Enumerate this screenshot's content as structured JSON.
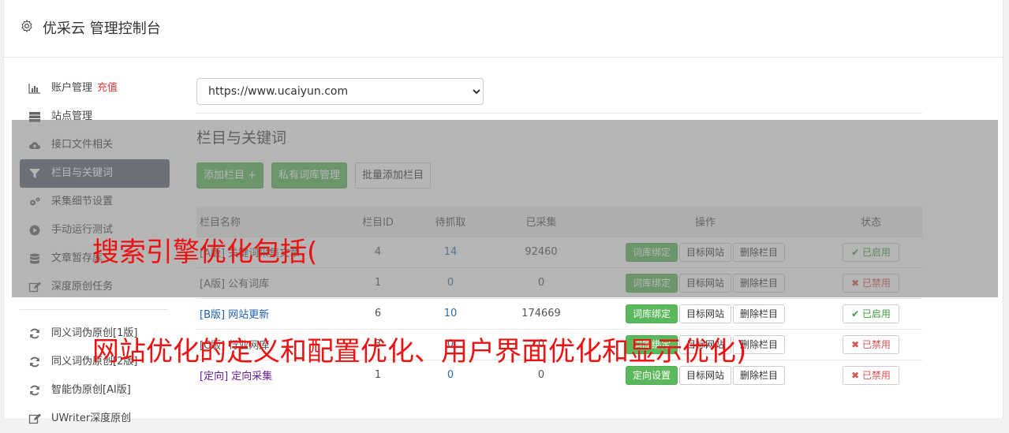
{
  "header": {
    "title": "优采云 管理控制台",
    "icon": "gear-icon"
  },
  "sidebar": {
    "group1": [
      {
        "label": "账户管理",
        "extra": "充值",
        "icon": "bar-chart-icon"
      },
      {
        "label": "站点管理",
        "icon": "server-icon"
      },
      {
        "label": "接口文件相关",
        "icon": "cloud-upload-icon"
      },
      {
        "label": "栏目与关键词",
        "icon": "filter-icon",
        "active": true
      },
      {
        "label": "采集细节设置",
        "icon": "cogs-icon"
      },
      {
        "label": "手动运行测试",
        "icon": "play-circle-icon"
      },
      {
        "label": "文章暂存库",
        "icon": "database-icon"
      },
      {
        "label": "深度原创任务",
        "icon": "edit-icon"
      }
    ],
    "group2": [
      {
        "label": "同义词伪原创[1版]",
        "icon": "refresh-icon"
      },
      {
        "label": "同义词伪原创[2版]",
        "icon": "refresh-icon"
      },
      {
        "label": "智能伪原创[AI版]",
        "icon": "refresh-icon"
      },
      {
        "label": "UWriter深度原创",
        "icon": "edit-icon"
      }
    ]
  },
  "main": {
    "site_select": "https://www.ucaiyun.com",
    "section_title": "栏目与关键词",
    "buttons": {
      "add": "添加栏目 +",
      "private": "私有词库管理",
      "batch": "批量添加栏目"
    },
    "columns": [
      "栏目名称",
      "栏目ID",
      "待抓取",
      "已采集",
      "操作",
      "状态"
    ],
    "rows": [
      {
        "name": "[A版] 关键词采集文章",
        "id": "4",
        "pending": "14",
        "collected": "92460",
        "b1": "词库绑定",
        "b2": "目标网站",
        "b3": "删除栏目",
        "status": "✔ 已启用",
        "on": true
      },
      {
        "name": "[A版] 公有词库",
        "id": "1",
        "pending": "0",
        "collected": "0",
        "b1": "词库绑定",
        "b2": "目标网站",
        "b3": "删除栏目",
        "status": "✖ 已禁用",
        "on": false
      },
      {
        "name": "[B版] 网站更新",
        "id": "6",
        "pending": "10",
        "collected": "174669",
        "b1": "词库绑定",
        "b2": "目标网站",
        "b3": "删除栏目",
        "status": "✔ 已启用",
        "on": true
      },
      {
        "name": "[C版] 行业网库",
        "id": "3",
        "pending": "0",
        "collected": "0",
        "b1": "词库绑定",
        "b2": "目标网站",
        "b3": "删除栏目",
        "status": "✖ 已禁用",
        "on": false
      },
      {
        "name": "[定向] 定向采集",
        "id": "1",
        "pending": "0",
        "collected": "0",
        "b1": "定向设置",
        "b2": "目标网站",
        "b3": "删除栏目",
        "status": "✖ 已禁用",
        "on": false
      }
    ]
  },
  "overlay_text": {
    "line1": "搜索引擎优化包括(",
    "line2": "网站优化的定义和配置优化、用户界面优化和显示优化)"
  }
}
